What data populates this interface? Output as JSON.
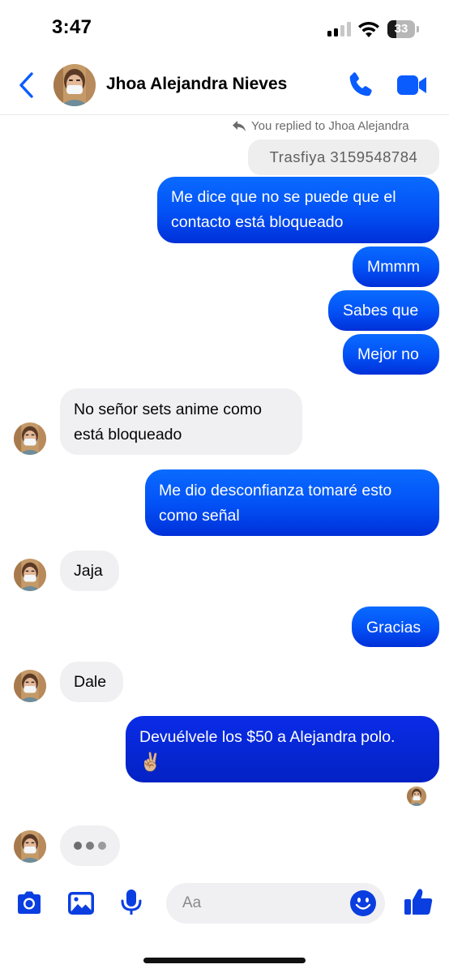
{
  "status_bar": {
    "time": "3:47",
    "battery_level": "33",
    "signal_bars_filled": 2,
    "signal_bars_total": 4,
    "battery_fraction": 0.33
  },
  "header": {
    "contact_name": "Jhoa Alejandra Nieves",
    "back_icon": "chevron-left-icon",
    "call_icon": "phone-icon",
    "video_icon": "video-camera-icon"
  },
  "reply_note": {
    "text": "You replied to Jhoa Alejandra",
    "icon": "reply-arrow-icon"
  },
  "quoted_message": {
    "text": "Trasfiya  3159548784"
  },
  "messages": [
    {
      "from": "me",
      "lines": [
        "Me dice que no se puede que el",
        "contacto está bloqueado"
      ]
    },
    {
      "from": "me",
      "lines": [
        "Mmmm"
      ]
    },
    {
      "from": "me",
      "lines": [
        "Sabes que"
      ]
    },
    {
      "from": "me",
      "lines": [
        "Mejor no"
      ]
    },
    {
      "from": "them",
      "lines": [
        "No señor sets anime como",
        "está bloqueado"
      ]
    },
    {
      "from": "me",
      "lines": [
        "Me dio desconfianza tomaré esto",
        "como señal"
      ]
    },
    {
      "from": "them",
      "lines": [
        "Jaja"
      ]
    },
    {
      "from": "me",
      "lines": [
        "Gracias"
      ]
    },
    {
      "from": "them",
      "lines": [
        "Dale"
      ]
    },
    {
      "from": "me",
      "lines": [
        "Devuélvele los $50 a Alejandra polo.",
        "✌🏼"
      ]
    }
  ],
  "typing_indicator": {
    "icon": "typing-dots-icon"
  },
  "composer": {
    "placeholder": "Aa",
    "camera_icon": "camera-icon",
    "gallery_icon": "image-icon",
    "mic_icon": "microphone-icon",
    "emoji_icon": "smiley-icon",
    "like_icon": "thumbs-up-icon"
  },
  "colors": {
    "accent": "#0a5cff",
    "outgoing_top": "#0a6bff",
    "outgoing_bottom": "#0030d8",
    "incoming_bg": "#f0f0f2",
    "text_secondary": "#6b6b6b"
  }
}
